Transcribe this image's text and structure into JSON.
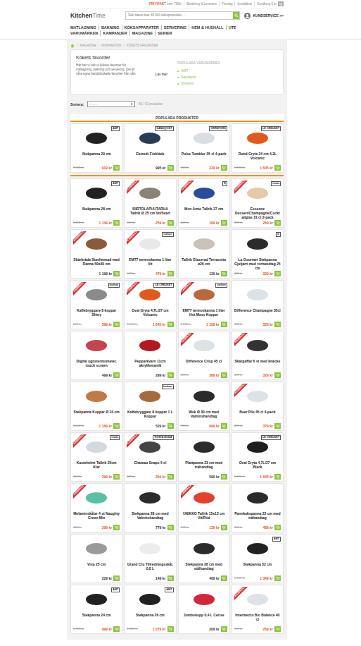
{
  "top_bar": {
    "promo": {
      "strong": "FRI FRAKT",
      "text": "över 750kr"
    },
    "links": [
      "Betalning & Leverans",
      "Företag",
      "kundtjänst"
    ],
    "cart": "Kundkorg 0 kr"
  },
  "logo": {
    "first": "Kitchen",
    "second": "Time"
  },
  "search": {
    "placeholder": "Sök bland över 45 000 köksprodukter...."
  },
  "account": {
    "label": "KUNDSERVICE >>"
  },
  "nav": [
    [
      "MATLAGNING",
      "BAKNING",
      "KÖKSAPPARATER",
      "SERVERING",
      "HEM & HUSHÅLL",
      "UTE"
    ],
    [
      "VARUMÄRKEN",
      "KAMPANJER",
      "MAGAZINE",
      "SERIER"
    ]
  ],
  "breadcrumb": {
    "separator": "/",
    "items": [
      "MAGAZINE",
      "INSPIRATION",
      "KÖKETS FAVORITER"
    ]
  },
  "intro": {
    "title": "Kökets favoriter",
    "text": "Här har vi valt ut kökets favoriter för matlagning, bakning och servering. Det är våra egna handplockade favoriter från vårt",
    "more": "Läs mer",
    "brands_title": "POPULÄRA VARUMÄRKEN",
    "brands": [
      "AMT",
      "Sandqvist",
      "Orrefors"
    ]
  },
  "sort": {
    "label": "Sortera:",
    "value": "-- . . .",
    "arrow": "▼",
    "count": "53 / 53 produkter"
  },
  "section_title": "POPULÄRA PRODUKTER",
  "campaign_label": "KAMPANJ",
  "products": [
    {
      "name": "Stekpanna 20 cm",
      "old": "1 699 kr",
      "price": "919 kr",
      "brand": "AMT",
      "campaign": false,
      "color": "#222222"
    },
    {
      "name": "Ekstedt Förkläde",
      "old": "",
      "price": "995 kr",
      "brand": "SANDQVIST",
      "campaign": false,
      "color": "#2a3d55"
    },
    {
      "name": "Pulse Tumbler 35 cl 4-pack",
      "old": "399 kr",
      "price": "229 kr",
      "brand": "ORREFORS",
      "campaign": false,
      "color": "#d9dee3"
    },
    {
      "name": "Rund Gryta 24 cm 4,2L Volcanic",
      "old": "2 199 kr",
      "price": "1 645 kr",
      "brand": "LE CREUSET",
      "campaign": false,
      "color": "#e2591c"
    },
    {
      "name": "Stekpanna 28 cm",
      "old": "1 499 kr",
      "price": "1 149 kr",
      "brand": "AMT",
      "campaign": false,
      "color": "#222222"
    },
    {
      "name": "SIIRTOLAPUUTARHA Tallrik Ø 25 cm Vit/Svart",
      "old": "369 kr",
      "price": "259 kr",
      "brand": "",
      "campaign": true,
      "color": "#8a8272"
    },
    {
      "name": "Mon Amie Tallrik 27 cm",
      "old": "249 kr",
      "price": "189 kr",
      "brand": "R",
      "campaign": true,
      "color": "#2b4c9b"
    },
    {
      "name": "Essence Dessert/Champagne/Cocktailglas 31 cl 2-pack",
      "old": "399 kr",
      "price": "269 kr",
      "brand": "iittala",
      "campaign": true,
      "color": "#e6c9a8"
    },
    {
      "name": "Skärbräda Stavlimmad med Ränna 50x30 cm",
      "old": "",
      "price": "1 199 kr",
      "brand": "",
      "campaign": true,
      "color": "#8a5a3a"
    },
    {
      "name": "EM77 termoskanna 1 liter Vit",
      "old": "639 kr",
      "price": "479 kr",
      "brand": "stelton",
      "campaign": true,
      "color": "#e8e8e8"
    },
    {
      "name": "Tallrik Glaserad Terracotta ø28 cm",
      "old": "",
      "price": "129 kr",
      "brand": "",
      "campaign": false,
      "color": "#c9c2b6"
    },
    {
      "name": "La Gourmet Stekpanna Gjutjärn med rörhandtag 25 cm",
      "old": "499 kr",
      "price": "329 kr",
      "brand": "G",
      "campaign": false,
      "color": "#2b2b2b"
    },
    {
      "name": "Kaffebryggare 8 koppar Shiny",
      "old": "529 kr",
      "price": "399 kr",
      "brand": "bodum",
      "campaign": true,
      "color": "#8a8a8a"
    },
    {
      "name": "Oval Gryta 4,7L/27 cm Volcanic",
      "old": "2 199 kr",
      "price": "1 645 kr",
      "brand": "LE CREUSET",
      "campaign": true,
      "color": "#e2591c"
    },
    {
      "name": "EM77 termoskanna 1 liter Hot Mess Kopper",
      "old": "1 899 kr",
      "price": "1 199 kr",
      "brand": "stelton",
      "campaign": true,
      "color": "#b86a3c"
    },
    {
      "name": "Difference Champagne 35cl",
      "old": "499 kr",
      "price": "329 kr",
      "brand": "",
      "campaign": false,
      "color": "#dde2e6"
    },
    {
      "name": "Digital ugnstermometer, touch screen",
      "old": "",
      "price": "499 kr",
      "brand": "",
      "campaign": false,
      "color": "#c2464f"
    },
    {
      "name": "Pepparkvarn 11cm akryl/keramik",
      "old": "",
      "price": "299 kr",
      "brand": "",
      "campaign": false,
      "color": "#b3191f"
    },
    {
      "name": "Difference Crisp 45 cl",
      "old": "499 kr",
      "price": "389 kr",
      "brand": "",
      "campaign": true,
      "color": "#dde2e6"
    },
    {
      "name": "Skärgaffar 6 st med knäcke",
      "old": "499 kr",
      "price": "329 kr",
      "brand": "",
      "campaign": true,
      "color": "#333333"
    },
    {
      "name": "Stekpanna Koppar Ø 24 cm",
      "old": "1 469 kr",
      "price": "1 169 kr",
      "brand": "",
      "campaign": false,
      "color": "#c07a4a"
    },
    {
      "name": "Kaffebryggare 8 koppar 1 L Koppar",
      "old": "",
      "price": "529 kr",
      "brand": "bodum",
      "campaign": false,
      "color": "#a86a3a"
    },
    {
      "name": "Wok Ø 30 cm med Valnötshandtag",
      "old": "999 kr",
      "price": "899 kr",
      "brand": "",
      "campaign": false,
      "color": "#2b2b2b"
    },
    {
      "name": "Beer Pils 45 cl 4-pack",
      "old": "499 kr",
      "price": "379 kr",
      "brand": "",
      "campaign": true,
      "color": "#dde2e6"
    },
    {
      "name": "Kastehelmi Tallrik 25cm Klar",
      "old": "419 kr",
      "price": "299 kr",
      "brand": "iittala",
      "campaign": true,
      "color": "#d3d9de"
    },
    {
      "name": "Chateau Snaps 5 cl",
      "old": "349 kr",
      "price": "259 kr",
      "brand": "KOSTA BODA",
      "campaign": true,
      "color": "#444444"
    },
    {
      "name": "Plattpanna 23 cm med trähandtag",
      "old": "",
      "price": "599 kr",
      "brand": "",
      "campaign": false,
      "color": "#2b2b2b"
    },
    {
      "name": "Oval Gryta 4,7L/27 cm Black",
      "old": "2 199 kr",
      "price": "1 645 kr",
      "brand": "LE CREUSET",
      "campaign": false,
      "color": "#1e1e1e"
    },
    {
      "name": "Melaminskålar 4 st Naughty Green Mix",
      "old": "419 kr",
      "price": "299 kr",
      "brand": "",
      "campaign": true,
      "color": "#5bbfa6"
    },
    {
      "name": "Stekpanna 28 cm med Valnötshandtag",
      "old": "",
      "price": "779 kr",
      "brand": "",
      "campaign": false,
      "color": "#2b2b2b"
    },
    {
      "name": "UNIKKO Tallrik 15x12 cm Vit/Röd",
      "old": "179 kr",
      "price": "139 kr",
      "brand": "",
      "campaign": true,
      "color": "#e2412e"
    },
    {
      "name": "Pannkakspanna 23 cm med trähandtag",
      "old": "599 kr",
      "price": "489 kr",
      "brand": "",
      "campaign": false,
      "color": "#2b2b2b"
    },
    {
      "name": "Visp 25 cm",
      "old": "",
      "price": "229 kr",
      "brand": "",
      "campaign": false,
      "color": "#9a9a9a"
    },
    {
      "name": "Grand Cru Tillredningsskål, 0,8 L",
      "old": "",
      "price": "149 kr",
      "brand": "",
      "campaign": false,
      "color": "#ececec"
    },
    {
      "name": "Stekpanna 28 cm med stålhandtag",
      "old": "",
      "price": "469 kr",
      "brand": "",
      "campaign": false,
      "color": "#2b2b2b"
    },
    {
      "name": "Stekpanna 32 cm",
      "old": "1 499 kr",
      "price": "1 349 kr",
      "brand": "AMT",
      "campaign": false,
      "color": "#222222"
    },
    {
      "name": "Stekpanna 24 cm",
      "old": "1 599 kr",
      "price": "999 kr",
      "brand": "AMT",
      "campaign": false,
      "color": "#222222"
    },
    {
      "name": "Stekpanna 26 cm",
      "old": "1 699 kr",
      "price": "1 079 kr",
      "brand": "AMT",
      "campaign": false,
      "color": "#222222"
    },
    {
      "name": "Jumbokopp 0,4 L Cerise",
      "old": "",
      "price": "209 kr",
      "brand": "",
      "campaign": false,
      "color": "#d3263a"
    },
    {
      "name": "Intermezzo Bio Balance 40 cl",
      "old": "399 kr",
      "price": "269 kr",
      "brand": "",
      "campaign": true,
      "color": "#dde2e6"
    }
  ]
}
